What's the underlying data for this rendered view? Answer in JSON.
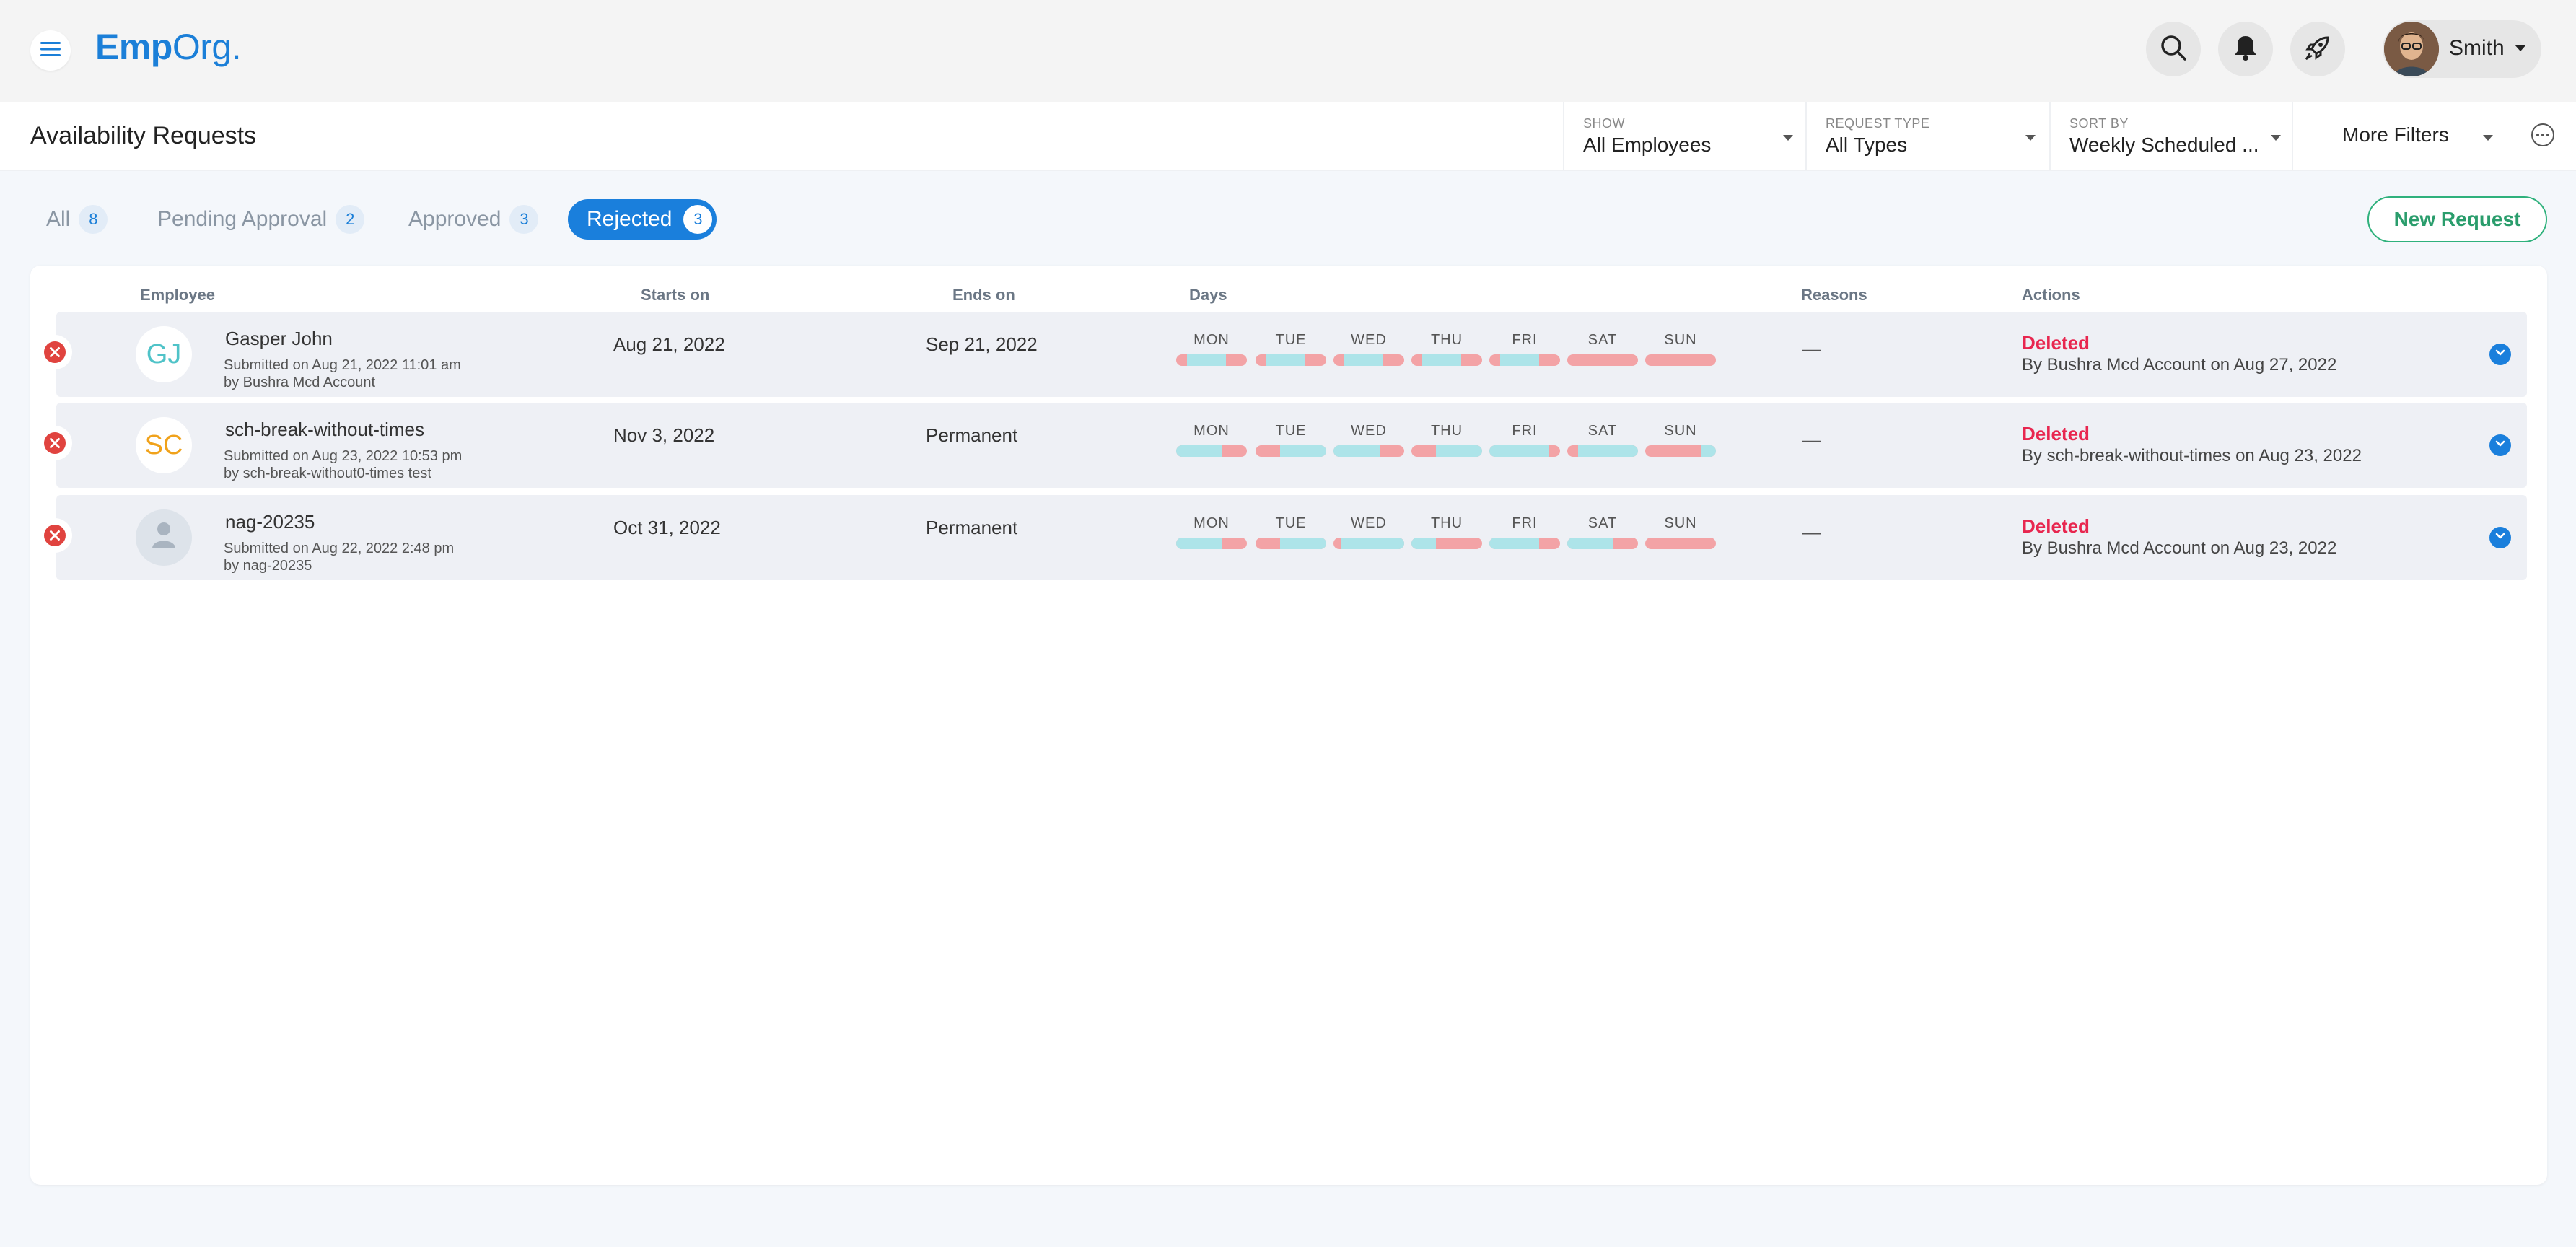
{
  "app": {
    "logo_bold": "Emp",
    "logo_rest": "Org."
  },
  "user": {
    "name": "Smith"
  },
  "header": {
    "title": "Availability Requests",
    "filters": [
      {
        "label": "SHOW",
        "value": "All Employees"
      },
      {
        "label": "REQUEST TYPE",
        "value": "All Types"
      },
      {
        "label": "SORT BY",
        "value": "Weekly Scheduled ..."
      }
    ],
    "more_filters": "More Filters"
  },
  "tabs": [
    {
      "label": "All",
      "count": "8"
    },
    {
      "label": "Pending Approval",
      "count": "2"
    },
    {
      "label": "Approved",
      "count": "3"
    },
    {
      "label": "Rejected",
      "count": "3",
      "active": true
    }
  ],
  "new_request": "New Request",
  "table": {
    "headers": {
      "employee": "Employee",
      "starts_on": "Starts on",
      "ends_on": "Ends on",
      "days": "Days",
      "reasons": "Reasons",
      "actions": "Actions"
    },
    "day_labels": [
      "MON",
      "TUE",
      "WED",
      "THU",
      "FRI",
      "SAT",
      "SUN"
    ],
    "rows": [
      {
        "initials": "GJ",
        "initials_color": "#4fc3c8",
        "name": "Gasper John",
        "submitted": "Submitted on Aug 21, 2022 11:01 am",
        "by": "by Bushra Mcd Account",
        "starts": "Aug 21, 2022",
        "ends": "Sep 21, 2022",
        "availability": [
          [
            0.15,
            0.7
          ],
          [
            0.15,
            0.7
          ],
          [
            0.15,
            0.7
          ],
          [
            0.15,
            0.7
          ],
          [
            0.15,
            0.7
          ],
          [
            0,
            0
          ],
          [
            0,
            0
          ]
        ],
        "reason": "—",
        "status": "Deleted",
        "action_by": "By Bushra Mcd Account on Aug 27, 2022"
      },
      {
        "initials": "SC",
        "initials_color": "#f0a21b",
        "name": "sch-break-without-times",
        "submitted": "Submitted on Aug 23, 2022 10:53 pm",
        "by": "by sch-break-without0-times test",
        "starts": "Nov 3, 2022",
        "ends": "Permanent",
        "availability": [
          [
            0,
            0.65
          ],
          [
            0.35,
            1
          ],
          [
            0,
            0.65
          ],
          [
            0.35,
            1
          ],
          [
            0,
            0.85
          ],
          [
            0.15,
            1
          ],
          [
            0.8,
            1
          ]
        ],
        "reason": "—",
        "status": "Deleted",
        "action_by": "By sch-break-without-times on Aug 23, 2022"
      },
      {
        "initials": "",
        "initials_color": "",
        "name": "nag-20235",
        "submitted": "Submitted on Aug 22, 2022 2:48 pm",
        "by": "by nag-20235",
        "starts": "Oct 31, 2022",
        "ends": "Permanent",
        "availability": [
          [
            0,
            0.65
          ],
          [
            0.35,
            1
          ],
          [
            0.1,
            1
          ],
          [
            0,
            0.35
          ],
          [
            0,
            0.7
          ],
          [
            0,
            0.65
          ],
          [
            0,
            0
          ]
        ],
        "reason": "—",
        "status": "Deleted",
        "action_by": "By Bushra Mcd Account on Aug 23, 2022"
      }
    ]
  }
}
